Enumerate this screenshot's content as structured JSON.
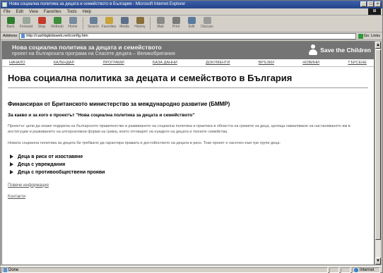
{
  "window": {
    "title": "Нова социална политика за децата и семейството в България - Microsoft Internet Explorer",
    "min": "_",
    "max": "□",
    "close": "×"
  },
  "menu": [
    "File",
    "Edit",
    "View",
    "Favorites",
    "Tools",
    "Help"
  ],
  "toolbar": [
    {
      "label": "Back",
      "icon": "back-icon",
      "color": "#2f7d2f"
    },
    {
      "label": "Forward",
      "icon": "forward-icon",
      "color": "#9aa79a"
    },
    {
      "label": "Stop",
      "icon": "stop-icon",
      "color": "#c33a2a"
    },
    {
      "label": "Refresh",
      "icon": "refresh-icon",
      "color": "#3d8f3d"
    },
    {
      "label": "Home",
      "icon": "home-icon",
      "color": "#7a8aa0"
    },
    {
      "label": "Search",
      "icon": "search-icon",
      "color": "#6a7f98"
    },
    {
      "label": "Favorites",
      "icon": "favorites-icon",
      "color": "#c9a43a"
    },
    {
      "label": "Media",
      "icon": "media-icon",
      "color": "#5c6f8a"
    },
    {
      "label": "History",
      "icon": "history-icon",
      "color": "#8a6f3a"
    },
    {
      "label": "Mail",
      "icon": "mail-icon",
      "color": "#8a8a8a"
    },
    {
      "label": "Print",
      "icon": "print-icon",
      "color": "#7a7a7a"
    },
    {
      "label": "Edit",
      "icon": "edit-icon",
      "color": "#5a7aa0"
    },
    {
      "label": "Discuss",
      "icon": "discuss-icon",
      "color": "#9a9a9a"
    }
  ],
  "address": {
    "label": "Address",
    "url": "http://cashbgkidsweb.net/config.htm",
    "go": "Go",
    "links": "Links"
  },
  "banner": {
    "title": "Нова социална политика за децата и семейството",
    "subtitle": "проект на българската програма на Спасете децата – Великобритания",
    "logo_text": "Save the Children"
  },
  "nav": [
    "НАЧАЛО",
    "КАЛЕНДАР",
    "ПРОГРАМИ",
    "БАЗА ДАННИ",
    "ДОКУМЕНТИ",
    "ВРЪЗКИ",
    "НОВИНИ",
    "ТЪРСЕНЕ"
  ],
  "page": {
    "title": "Нова социална политика за децата и семейството в България",
    "funded_by": "Финансиран от Британското министерство за международно развитие (БММР)",
    "question": "За какво и за кого е проектът \"Нова социална политика за децата и семейството\"",
    "para1": "Проектът цели да окаже подкрепа на българското правителство в развиването на социална политика и практика в областта на грижите за деца, целяща намаляване на настаняването им в институции и развиването на алтернативни форми на грижа, които отговарят на нуждите на децата и техните семейства.",
    "para2": "Новата социална политика за децата би трябвало да гарантира правата и достойнството на децата в риск. Този проект е насочен към три групи деца:",
    "bullets": [
      "Деца в риск от изоставяне",
      "Деца с увреждания",
      "Деца с противообществени прояви"
    ],
    "more_link": "Повече информация",
    "contacts_link": "Контакти"
  },
  "status": {
    "text": "Done",
    "zone": "Internet"
  }
}
